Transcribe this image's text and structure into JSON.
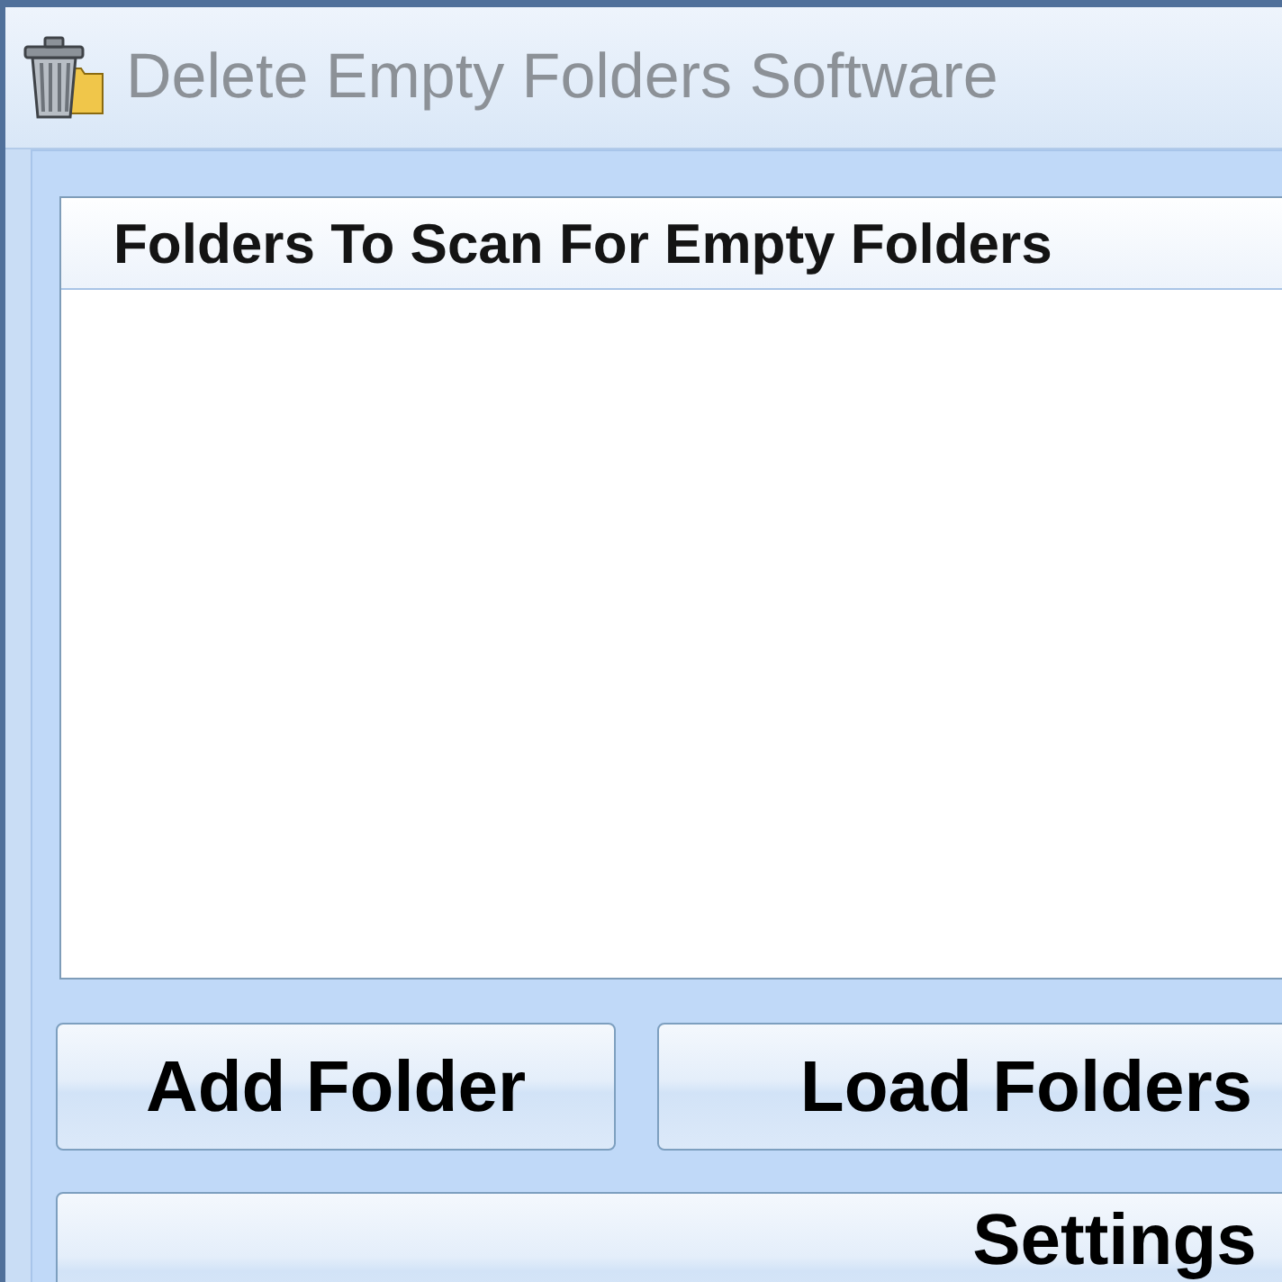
{
  "window": {
    "title": "Delete Empty Folders Software"
  },
  "folder_list": {
    "column_header": "Folders To Scan For Empty Folders"
  },
  "button_rows": [
    {
      "buttons": [
        {
          "label": "Add Folder"
        },
        {
          "label": "Load Folders"
        }
      ]
    },
    {
      "buttons": [
        {
          "label": "Settings"
        }
      ]
    }
  ]
}
